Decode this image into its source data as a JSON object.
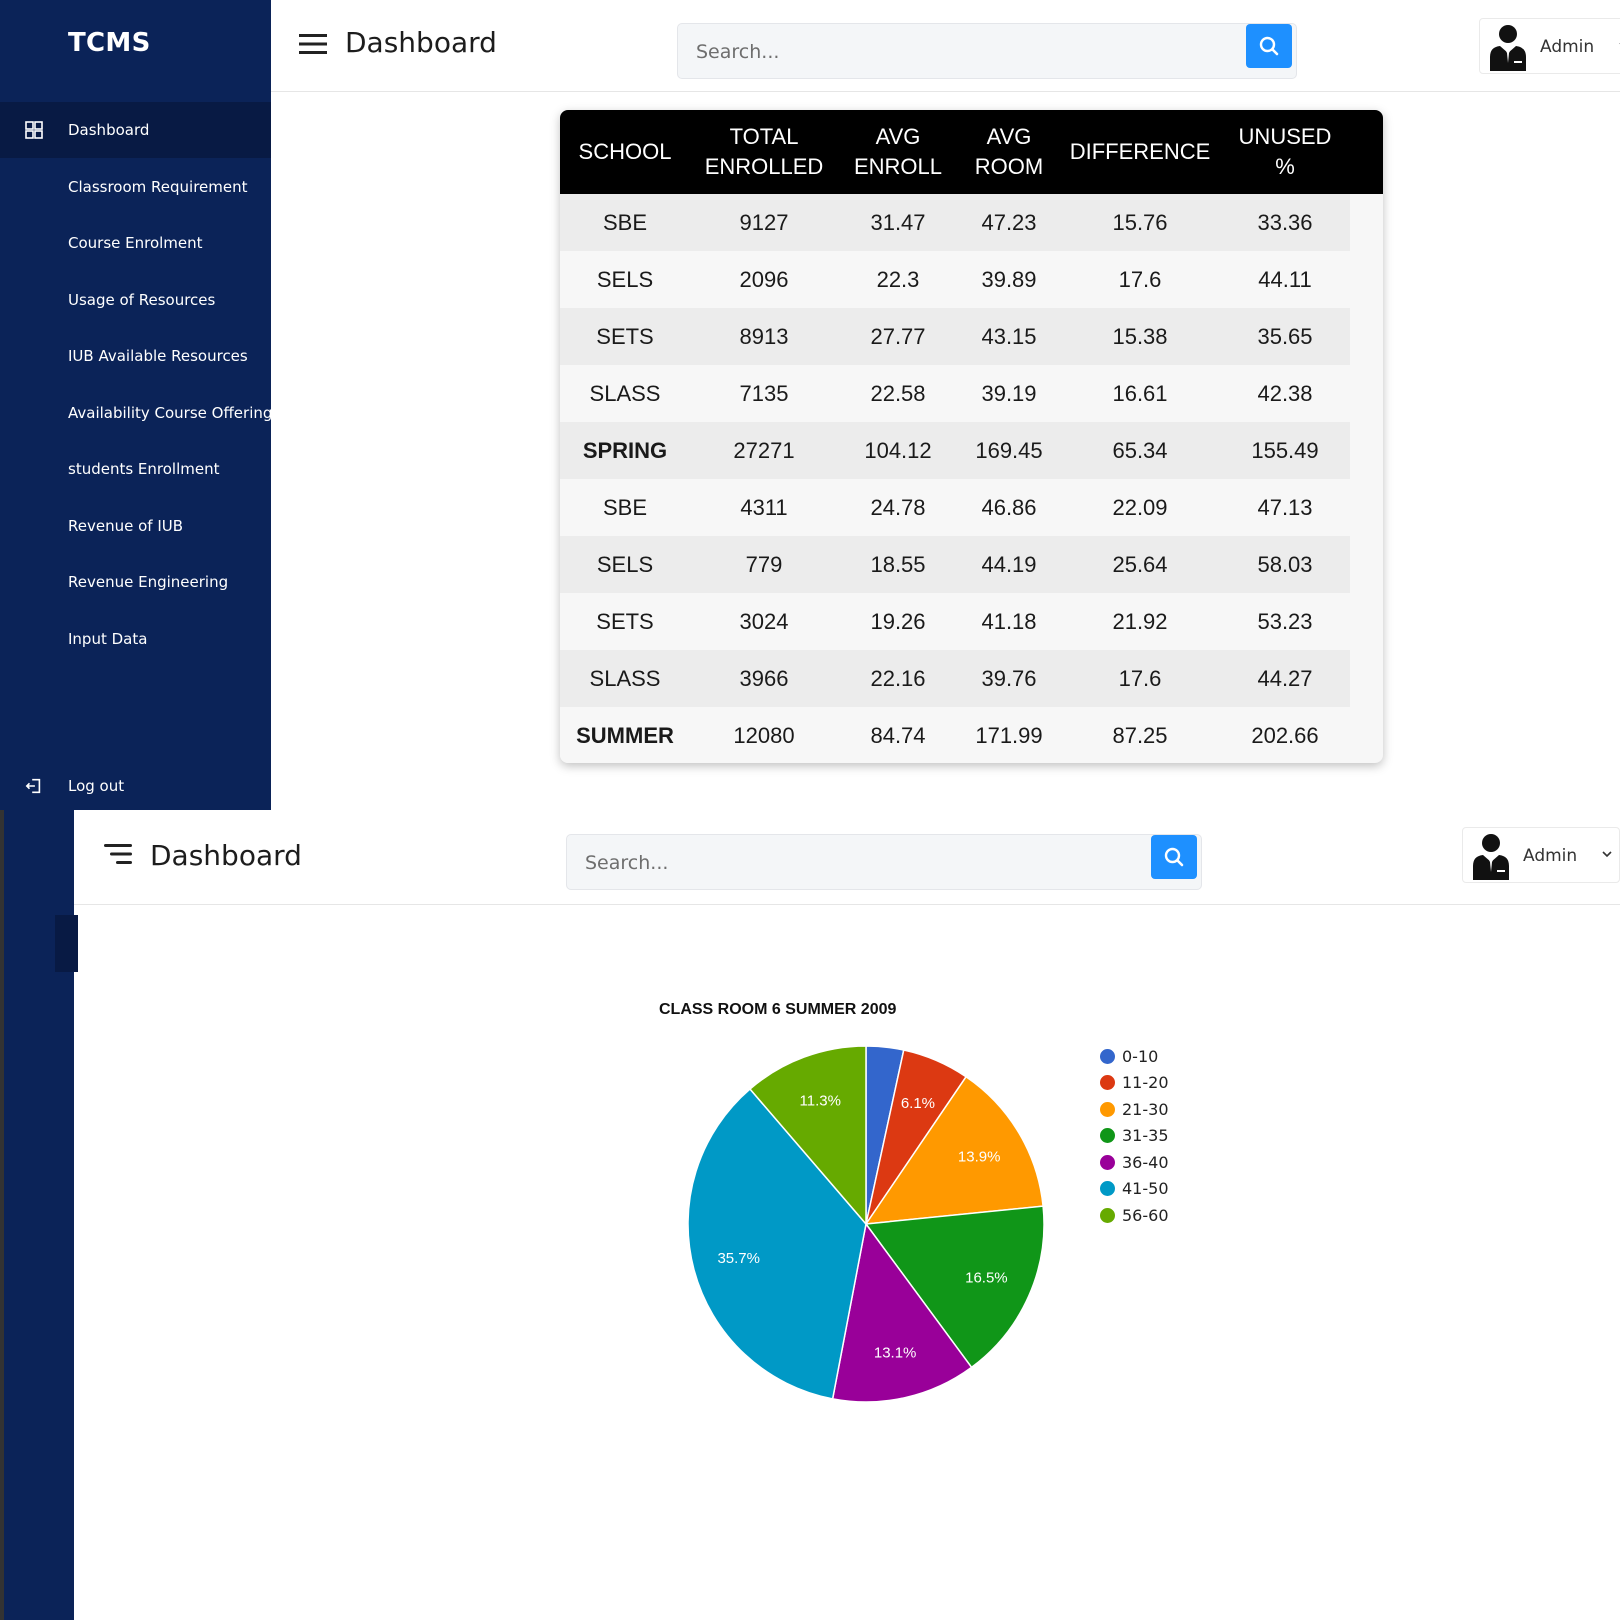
{
  "app": {
    "brand": "TCMS"
  },
  "header": {
    "title": "Dashboard",
    "search_placeholder": "Search...",
    "user_name": "Admin"
  },
  "sidebar": {
    "items": [
      {
        "label": "Dashboard",
        "icon": "grid-icon",
        "active": true
      },
      {
        "label": "Classroom Requirement"
      },
      {
        "label": "Course Enrolment"
      },
      {
        "label": "Usage of Resources"
      },
      {
        "label": "IUB Available Resources"
      },
      {
        "label": "Availability Course Offering"
      },
      {
        "label": "students Enrollment"
      },
      {
        "label": "Revenue of IUB"
      },
      {
        "label": "Revenue Engineering"
      },
      {
        "label": "Input Data"
      }
    ],
    "logout_label": "Log out"
  },
  "table": {
    "headers": [
      {
        "line1": "SCHOOL",
        "line2": ""
      },
      {
        "line1": "TOTAL",
        "line2": "ENROLLED"
      },
      {
        "line1": "AVG",
        "line2": "ENROLL"
      },
      {
        "line1": "AVG",
        "line2": "ROOM"
      },
      {
        "line1": "DIFFERENCE",
        "line2": ""
      },
      {
        "line1": "UNUSED",
        "line2": "%"
      }
    ],
    "rows": [
      [
        "SBE",
        "9127",
        "31.47",
        "47.23",
        "15.76",
        "33.36"
      ],
      [
        "SELS",
        "2096",
        "22.3",
        "39.89",
        "17.6",
        "44.11"
      ],
      [
        "SETS",
        "8913",
        "27.77",
        "43.15",
        "15.38",
        "35.65"
      ],
      [
        "SLASS",
        "7135",
        "22.58",
        "39.19",
        "16.61",
        "42.38"
      ],
      [
        "SPRING",
        "27271",
        "104.12",
        "169.45",
        "65.34",
        "155.49"
      ],
      [
        "SBE",
        "4311",
        "24.78",
        "46.86",
        "22.09",
        "47.13"
      ],
      [
        "SELS",
        "779",
        "18.55",
        "44.19",
        "25.64",
        "58.03"
      ],
      [
        "SETS",
        "3024",
        "19.26",
        "41.18",
        "21.92",
        "53.23"
      ],
      [
        "SLASS",
        "3966",
        "22.16",
        "39.76",
        "17.6",
        "44.27"
      ],
      [
        "SUMMER",
        "12080",
        "84.74",
        "171.99",
        "87.25",
        "202.66"
      ]
    ],
    "total_rows": [
      4,
      9
    ]
  },
  "chart_data": {
    "type": "pie",
    "title": "CLASS ROOM 6 SUMMER 2009",
    "legend_position": "right",
    "categories": [
      "0-10",
      "11-20",
      "21-30",
      "31-35",
      "36-40",
      "41-50",
      "56-60"
    ],
    "values": [
      3.4,
      6.1,
      13.9,
      16.5,
      13.1,
      35.7,
      11.3
    ],
    "data_labels": [
      "",
      "6.1%",
      "13.9%",
      "16.5%",
      "13.1%",
      "35.7%",
      "11.3%"
    ],
    "colors": [
      "#3366cc",
      "#dc3912",
      "#ff9900",
      "#109618",
      "#990099",
      "#0099c6",
      "#66aa00"
    ]
  }
}
